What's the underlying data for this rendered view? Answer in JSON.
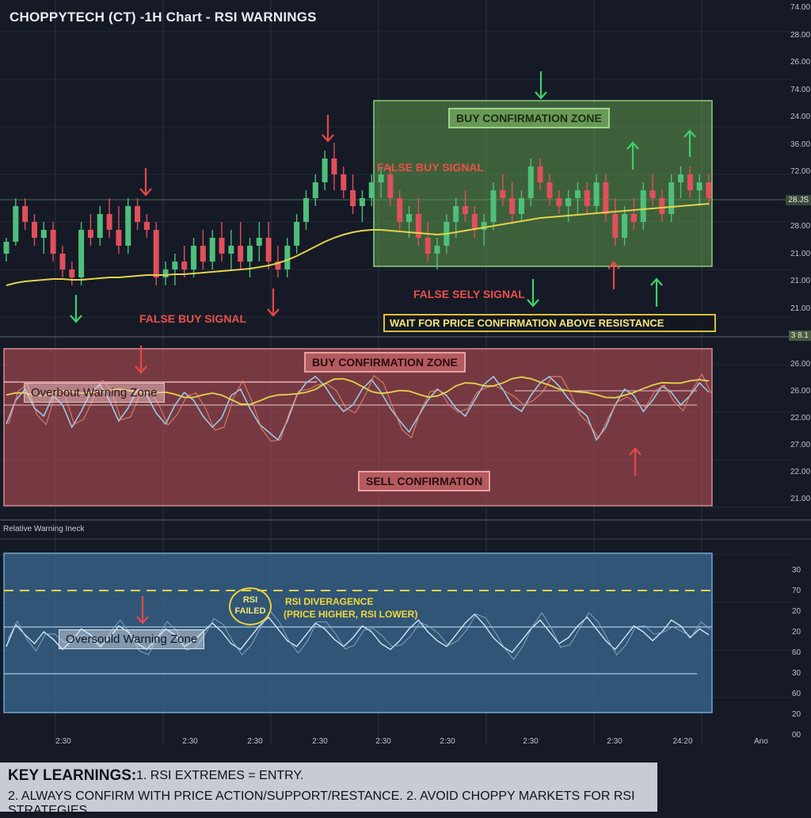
{
  "header": {
    "title": "CHOPPYTECH (CT) -1H Chart - RSI WARNINGS"
  },
  "annotations": {
    "buy_zone_top": "BUY CONFIRMATION ZONE",
    "false_buy_top": "FALSE BUY SIGNAL",
    "false_buy_bottom": "FALSE BUY SIGNAL",
    "false_sell": "FALSE SELY SIGNAL",
    "wait_for": "WAIT FOR PRICE CONFIRMATION ABOVE RESISTANCE",
    "buy_zone_mid": "BUY CONFIRMATION ZONE",
    "overbought_warning": "Overbout Warning Zone",
    "sell_confirmation": "SELL CONFIRMATION",
    "indicator_label": "Relative Warning Ineck",
    "oversold_warning": "Oversould Warning Zone",
    "rsi_failed_1": "RSI",
    "rsi_failed_2": "FAILED",
    "rsi_divergence_1": "RSI DIVERAGENCE",
    "rsi_divergence_2": "(PRICE HIGHER, RSI LOWER)"
  },
  "price_axis": [
    "74.00",
    "28.00",
    "26.00",
    "74.00",
    "24.00",
    "36.00",
    "72.00",
    "28.00",
    "28.00",
    "21.00",
    "21.00",
    "21.00"
  ],
  "price_tag_1": "28.JS",
  "price_tag_2": "3 8.1",
  "mid_axis": [
    "26.00",
    "26.00",
    "22.00",
    "27.00",
    "22.00",
    "21.00"
  ],
  "rsi_axis": [
    "30",
    "70",
    "20",
    "20",
    "60",
    "30",
    "60",
    "20",
    "00"
  ],
  "x_ticks": [
    "2:30",
    "2:30",
    "2:30",
    "2:30",
    "2:30",
    "2:30",
    "2:30",
    "2:30",
    "24:20"
  ],
  "x_end": "Ano",
  "learnings": {
    "heading": "KEY LEARNINGS:",
    "item1": "1. RSI EXTREMES = ENTRY.",
    "line2": "2. ALWAYS CONFIRM WITH PRICE ACTION/SUPPORT/RESTANCE. 2. AVOID CHOPPY MARKETS FOR RSI STRATEGIES."
  },
  "colors": {
    "background": "#151a26",
    "bull": "#4fbf7a",
    "bear": "#e0505a",
    "ma": "#e3d34a",
    "rsi": "#9cc9e6",
    "green_zone": "#5f9a4c",
    "red_zone": "#b84e55",
    "blue_zone": "#3c6f98",
    "arrow_green": "#3fd16e",
    "arrow_red": "#e84848"
  },
  "chart_data": {
    "type": "candlestick",
    "candles": [
      [
        48,
        50,
        47,
        49.5
      ],
      [
        49.5,
        55,
        49,
        54
      ],
      [
        54,
        55,
        51,
        52
      ],
      [
        52,
        53,
        49,
        50
      ],
      [
        50,
        52,
        48,
        51
      ],
      [
        51,
        52,
        47,
        48
      ],
      [
        48,
        49,
        45,
        46
      ],
      [
        46,
        47,
        44,
        45
      ],
      [
        45,
        52,
        44,
        51
      ],
      [
        51,
        53,
        49,
        50
      ],
      [
        50,
        54,
        49,
        53
      ],
      [
        53,
        55,
        50,
        51
      ],
      [
        51,
        54,
        48,
        49
      ],
      [
        49,
        55,
        48,
        54
      ],
      [
        54,
        55,
        51,
        52
      ],
      [
        52,
        53,
        50,
        51
      ],
      [
        51,
        52,
        44,
        45
      ],
      [
        45,
        47,
        44,
        46
      ],
      [
        46,
        48,
        44,
        47
      ],
      [
        47,
        49,
        45,
        46
      ],
      [
        46,
        50,
        45,
        49
      ],
      [
        49,
        51,
        46,
        47
      ],
      [
        47,
        51,
        46,
        50
      ],
      [
        50,
        52,
        47,
        48
      ],
      [
        48,
        51,
        46,
        49
      ],
      [
        49,
        52,
        46,
        47
      ],
      [
        47,
        50,
        45,
        49
      ],
      [
        49,
        52,
        47,
        50
      ],
      [
        50,
        52,
        46,
        47
      ],
      [
        47,
        49,
        45,
        46
      ],
      [
        46,
        50,
        45,
        49
      ],
      [
        49,
        53,
        48,
        52
      ],
      [
        52,
        56,
        51,
        55
      ],
      [
        55,
        58,
        54,
        57
      ],
      [
        57,
        61,
        56,
        60
      ],
      [
        60,
        62,
        56,
        58
      ],
      [
        58,
        59,
        55,
        56
      ],
      [
        56,
        58,
        53,
        54
      ],
      [
        54,
        56,
        52,
        55
      ],
      [
        55,
        58,
        54,
        57
      ],
      [
        57,
        59,
        55,
        58
      ],
      [
        58,
        59,
        54,
        55
      ],
      [
        55,
        56,
        51,
        52
      ],
      [
        52,
        54,
        50,
        53
      ],
      [
        53,
        55,
        49,
        50
      ],
      [
        50,
        52,
        47,
        48
      ],
      [
        48,
        50,
        46,
        49
      ],
      [
        49,
        53,
        48,
        52
      ],
      [
        52,
        55,
        50,
        54
      ],
      [
        54,
        56,
        52,
        53
      ],
      [
        53,
        54,
        50,
        51
      ],
      [
        51,
        53,
        49,
        52
      ],
      [
        52,
        57,
        51,
        56
      ],
      [
        56,
        58,
        54,
        55
      ],
      [
        55,
        57,
        52,
        53
      ],
      [
        53,
        56,
        52,
        55
      ],
      [
        55,
        60,
        54,
        59
      ],
      [
        59,
        60,
        56,
        57
      ],
      [
        57,
        58,
        54,
        55
      ],
      [
        55,
        56,
        53,
        54
      ],
      [
        54,
        56,
        52,
        55
      ],
      [
        55,
        57,
        53,
        56
      ],
      [
        56,
        57,
        53,
        54
      ],
      [
        54,
        58,
        53,
        57
      ],
      [
        57,
        58,
        52,
        53
      ],
      [
        53,
        55,
        49,
        50
      ],
      [
        50,
        54,
        49,
        53
      ],
      [
        53,
        55,
        51,
        52
      ],
      [
        52,
        57,
        51,
        56
      ],
      [
        56,
        58,
        54,
        55
      ],
      [
        55,
        56,
        52,
        53
      ],
      [
        53,
        58,
        52,
        57
      ],
      [
        57,
        59,
        55,
        58
      ],
      [
        58,
        59,
        55,
        56
      ],
      [
        56,
        58,
        54,
        57
      ],
      [
        57,
        58,
        54,
        55
      ]
    ],
    "moving_average": [
      44,
      44.3,
      44.5,
      44.6,
      44.7,
      44.8,
      44.8,
      44.7,
      44.7,
      44.8,
      44.9,
      45,
      45,
      45.1,
      45.2,
      45.3,
      45.3,
      45.3,
      45.4,
      45.4,
      45.5,
      45.6,
      45.7,
      45.8,
      45.9,
      46,
      46.1,
      46.3,
      46.5,
      46.8,
      47.2,
      47.7,
      48.3,
      48.9,
      49.5,
      50,
      50.4,
      50.7,
      50.9,
      51,
      51,
      50.9,
      50.8,
      50.7,
      50.6,
      50.5,
      50.4,
      50.5,
      50.7,
      50.9,
      51.1,
      51.3,
      51.5,
      51.7,
      51.9,
      52.1,
      52.3,
      52.5,
      52.6,
      52.7,
      52.8,
      52.9,
      53,
      53.1,
      53.2,
      53.3,
      53.4,
      53.5,
      53.6,
      53.7,
      53.8,
      53.9,
      54,
      54.1,
      54.2,
      54.3
    ],
    "rsi_overbought_panel": [
      40,
      55,
      62,
      50,
      45,
      58,
      52,
      38,
      48,
      60,
      65,
      55,
      42,
      50,
      62,
      58,
      47,
      40,
      52,
      60,
      55,
      45,
      38,
      44,
      58,
      62,
      50,
      40,
      35,
      30,
      42,
      58,
      66,
      70,
      64,
      55,
      48,
      52,
      62,
      68,
      60,
      50,
      42,
      35,
      45,
      55,
      62,
      58,
      50,
      45,
      55,
      65,
      70,
      62,
      52,
      48,
      58,
      66,
      70,
      64,
      56,
      50,
      45,
      30,
      38,
      52,
      62,
      58,
      48,
      55,
      64,
      60,
      52,
      58,
      66,
      60
    ],
    "rsi_oversold_panel": [
      40,
      55,
      48,
      42,
      50,
      45,
      38,
      44,
      52,
      48,
      40,
      46,
      54,
      50,
      42,
      38,
      45,
      52,
      48,
      40,
      44,
      50,
      56,
      50,
      42,
      38,
      46,
      54,
      60,
      52,
      44,
      40,
      48,
      56,
      52,
      45,
      40,
      46,
      54,
      50,
      42,
      38,
      44,
      52,
      58,
      50,
      44,
      40,
      48,
      56,
      62,
      55,
      46,
      40,
      36,
      44,
      52,
      58,
      50,
      42,
      46,
      54,
      60,
      52,
      44,
      38,
      46,
      54,
      50,
      44,
      50,
      58,
      54,
      46,
      52,
      48
    ],
    "series": [
      {
        "name": "",
        "values": []
      }
    ]
  }
}
